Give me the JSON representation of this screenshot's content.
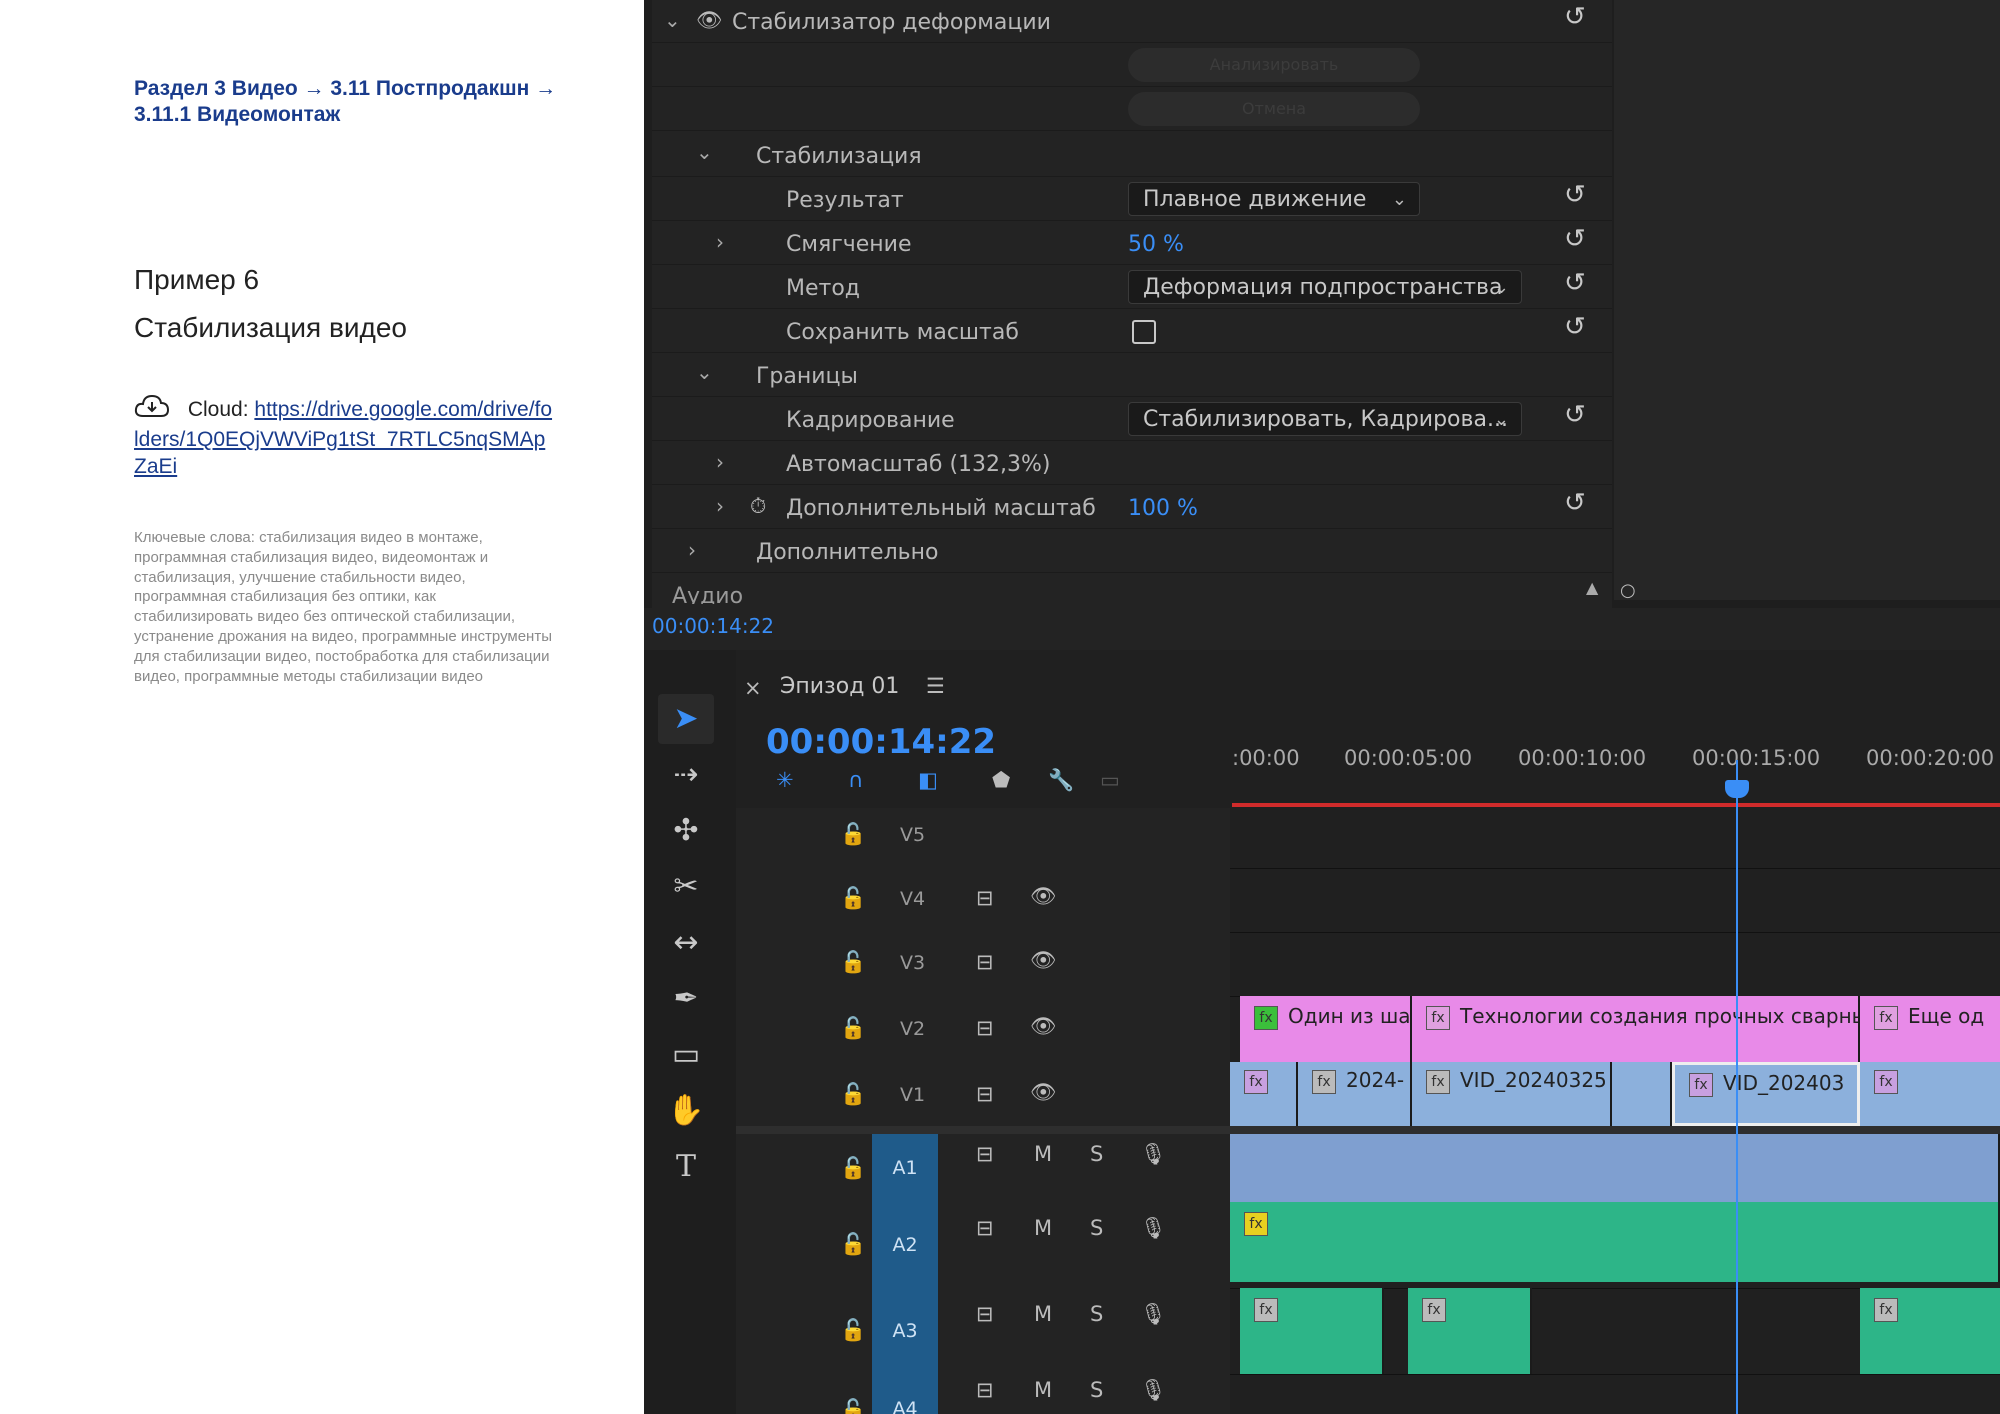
{
  "doc": {
    "breadcrumb": "Раздел 3 Видео  → 3.11 Постпродакшн → 3.11.1 Видеомонтаж",
    "example_number": "Пример 6",
    "example_title": "Стабилизация видео",
    "cloud_label": "Cloud:",
    "cloud_link": "https://drive.google.com/drive/folders/1Q0EQjVWViPg1tSt_7RTLC5nqSMApZaEi",
    "keywords": "Ключевые слова: стабилизация видео в монтаже, программная стабилизация видео, видеомонтаж и стабилизация, улучшение стабильности видео, программная стабилизация без оптики, как стабилизировать видео без оптической стабилизации, устранение дрожания на видео, программные инструменты для стабилизации видео, постобработка для стабилизации видео, программные методы стабилизации видео"
  },
  "effect_controls": {
    "effect_name": "Стабилизатор деформации",
    "analyze_button": "Анализировать",
    "cancel_button": "Отмена",
    "stabilization_section": "Стабилизация",
    "result_label": "Результат",
    "result_value": "Плавное движение",
    "smoothing_label": "Смягчение",
    "smoothing_value": "50 %",
    "method_label": "Метод",
    "method_value": "Деформация подпространства",
    "preserve_scale_label": "Сохранить масштаб",
    "borders_section": "Границы",
    "framing_label": "Кадрирование",
    "framing_value": "Стабилизировать, Кадрирова...",
    "autoscale_label": "Автомасштаб (132,3%)",
    "extra_scale_label": "Дополнительный масштаб",
    "extra_scale_value": "100 %",
    "advanced_section": "Дополнительно",
    "audio_section": "Аудио",
    "timecode": "00:00:14:22"
  },
  "timeline": {
    "sequence_tab": "Эпизод 01",
    "timecode": "00:00:14:22",
    "ruler": [
      ":00:00",
      "00:00:05:00",
      "00:00:10:00",
      "00:00:15:00",
      "00:00:20:00"
    ],
    "video_tracks": [
      "V5",
      "V4",
      "V3",
      "V2",
      "V1"
    ],
    "audio_tracks": [
      "A1",
      "A2",
      "A3",
      "A4"
    ],
    "mute_label": "M",
    "solo_label": "S",
    "v2_clips": [
      "Один из ша",
      "Технологии создания прочных сварных с",
      "Еще од"
    ],
    "v1_clips": [
      "2024-",
      "VID_20240325",
      "VID_202403"
    ]
  },
  "colors": {
    "accent_blue": "#3a8ef6",
    "title_clip_pink": "#e88ae8",
    "video_clip_blue": "#8cb0dc",
    "audio_green": "#2db588",
    "playhead_red": "#d02b2b"
  }
}
